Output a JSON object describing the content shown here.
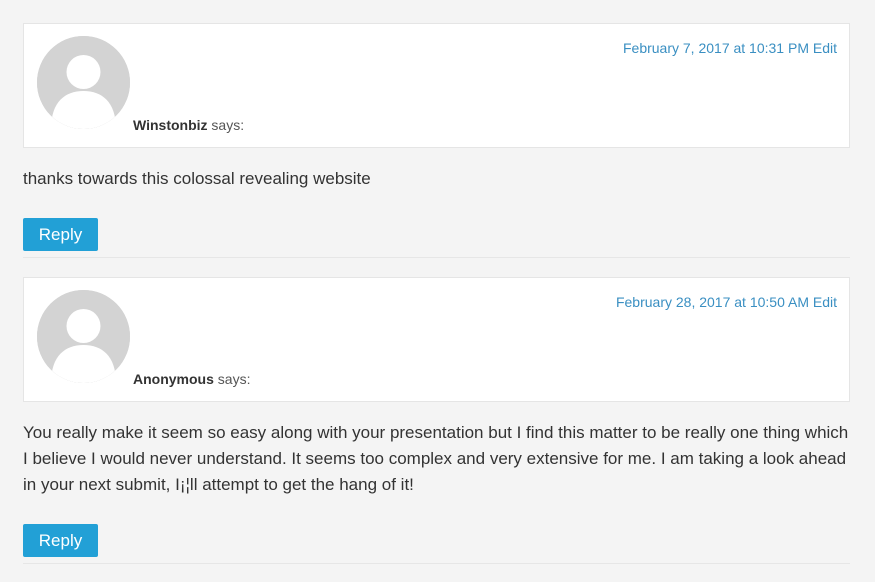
{
  "comments": [
    {
      "date": "February 7, 2017 at 10:31 PM",
      "edit_label": "Edit",
      "author": "Winstonbiz",
      "says": "says:",
      "body": "thanks towards this colossal revealing website",
      "reply_label": "Reply"
    },
    {
      "date": "February 28, 2017 at 10:50 AM",
      "edit_label": "Edit",
      "author": "Anonymous",
      "says": "says:",
      "body": "You really make it seem so easy along with your presentation but I find this matter to be really one thing which I believe I would never understand. It seems too complex and very extensive for me. I am taking a look ahead in your next submit, I¡¦ll attempt to get the hang of it!",
      "reply_label": "Reply"
    }
  ],
  "icons": {
    "avatar": "default-avatar-icon"
  },
  "colors": {
    "background": "#f4f4f4",
    "card": "#ffffff",
    "link": "#3a8fc2",
    "button": "#22a0d6"
  }
}
